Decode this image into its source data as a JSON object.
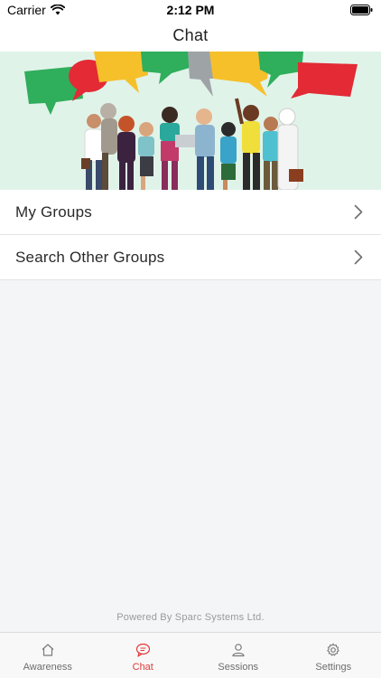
{
  "status_bar": {
    "carrier": "Carrier",
    "time": "2:12 PM"
  },
  "header": {
    "title": "Chat"
  },
  "banner": {
    "image": "people-chatting-illustration"
  },
  "menu": {
    "items": [
      {
        "label": "My Groups",
        "icon": "chevron-right-icon"
      },
      {
        "label": "Search Other Groups",
        "icon": "chevron-right-icon"
      }
    ]
  },
  "footer": {
    "powered_by": "Powered By Sparc Systems Ltd."
  },
  "tab_bar": {
    "active_color": "#e03a3a",
    "inactive_color": "#6d6d6d",
    "tabs": [
      {
        "label": "Awareness",
        "icon": "home-icon",
        "active": false
      },
      {
        "label": "Chat",
        "icon": "chat-bubble-icon",
        "active": true
      },
      {
        "label": "Sessions",
        "icon": "users-icon",
        "active": false
      },
      {
        "label": "Settings",
        "icon": "gear-icon",
        "active": false
      }
    ]
  }
}
